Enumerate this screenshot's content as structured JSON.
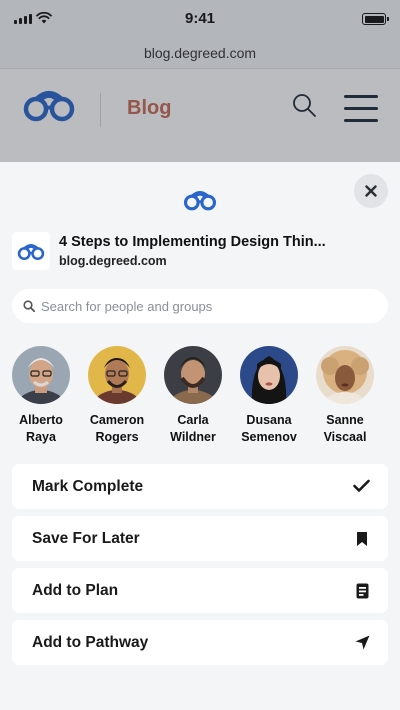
{
  "status_bar": {
    "time": "9:41"
  },
  "browser": {
    "url": "blog.degreed.com"
  },
  "site": {
    "section": "Blog"
  },
  "article": {
    "title": "4 Steps to Implementing Design Thin...",
    "source": "blog.degreed.com"
  },
  "search": {
    "placeholder": "Search for people and groups",
    "value": ""
  },
  "people": [
    {
      "first": "Alberto",
      "last": "Raya"
    },
    {
      "first": "Cameron",
      "last": "Rogers"
    },
    {
      "first": "Carla",
      "last": "Wildner"
    },
    {
      "first": "Dusana",
      "last": "Semenov"
    },
    {
      "first": "Sanne",
      "last": "Viscaal"
    }
  ],
  "actions": [
    {
      "label": "Mark Complete",
      "icon": "checkmark-icon"
    },
    {
      "label": "Save For Later",
      "icon": "bookmark-icon"
    },
    {
      "label": "Add to Plan",
      "icon": "plan-icon"
    },
    {
      "label": "Add to Pathway",
      "icon": "navigation-arrow-icon"
    }
  ],
  "colors": {
    "brand": "#2a66c9",
    "blog_accent": "#c96a53",
    "sheet_bg": "#f4f5f7"
  }
}
